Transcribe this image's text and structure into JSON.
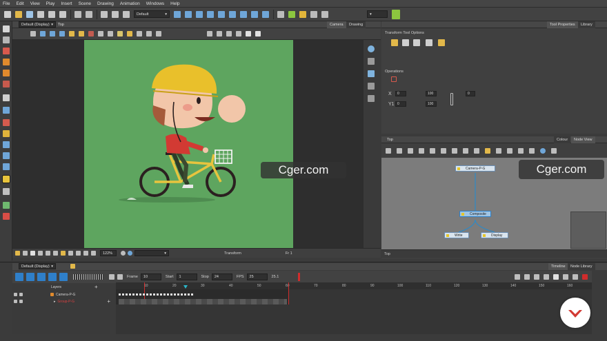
{
  "menubar": {
    "items": [
      "File",
      "Edit",
      "View",
      "Play",
      "Insert",
      "Scene",
      "Drawing",
      "Animation",
      "Windows",
      "Help"
    ]
  },
  "toolbar": {
    "mode_dropdown": "Default",
    "accent_green": "#8cc63f"
  },
  "camera_view": {
    "view_dropdown": "Default (Display)",
    "breadcrumb": "Top",
    "tabs": [
      "Camera",
      "Drawing"
    ],
    "zoom": "122%",
    "status_center": "Transform",
    "frame_readout": "Fr 1",
    "stage_color": "#5ea55f"
  },
  "tool_properties": {
    "tabs": [
      "Tool Properties",
      "Library"
    ],
    "section_title": "Transform Tool Options",
    "operations_label": "Operations",
    "x_label": "X",
    "y_label": "Y1",
    "x_value": "0",
    "y_value": "0",
    "scale_x": "100",
    "scale_y": "100",
    "angle_value": "0"
  },
  "node_view": {
    "breadcrumb": "Top",
    "tabs": [
      "Colour",
      "Node View"
    ],
    "status": "Top",
    "nodes": {
      "camera": "Camera-P-G",
      "composite": "Composite",
      "write": "Write",
      "display": "Display"
    }
  },
  "watermarks": [
    "Cger.com",
    "Cger.com"
  ],
  "timeline": {
    "view_dropdown": "Default (Display)",
    "tabs": [
      "Timeline",
      "Node Library"
    ],
    "frame_label": "Frame",
    "frame_value": "10",
    "start_label": "Start",
    "start_value": "1",
    "stop_label": "Stop",
    "stop_value": "24",
    "fps_label": "FPS",
    "fps_value": "25",
    "fps_actual": "25.1",
    "layers_header": "Layers",
    "layers": [
      "Camera-P-G",
      "Group-P-G"
    ],
    "ruler": [
      "10",
      "20",
      "30",
      "40",
      "50",
      "60",
      "70",
      "80",
      "90",
      "100",
      "110",
      "120",
      "130",
      "140",
      "150",
      "160"
    ]
  }
}
